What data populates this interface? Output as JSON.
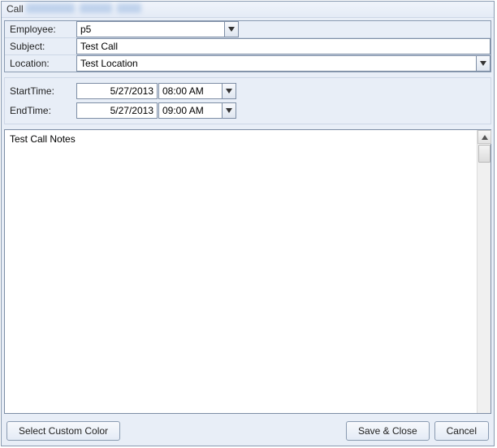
{
  "window": {
    "title": "Call"
  },
  "fields": {
    "employee": {
      "label": "Employee:",
      "value": "p5"
    },
    "subject": {
      "label": "Subject:",
      "value": "Test Call"
    },
    "location": {
      "label": "Location:",
      "value": "Test Location"
    },
    "startTime": {
      "label": "StartTime:",
      "date": "5/27/2013",
      "time": "08:00 AM"
    },
    "endTime": {
      "label": "EndTime:",
      "date": "5/27/2013",
      "time": "09:00 AM"
    }
  },
  "notes": {
    "value": "Test Call Notes"
  },
  "buttons": {
    "selectColor": "Select Custom Color",
    "saveClose": "Save & Close",
    "cancel": "Cancel"
  }
}
